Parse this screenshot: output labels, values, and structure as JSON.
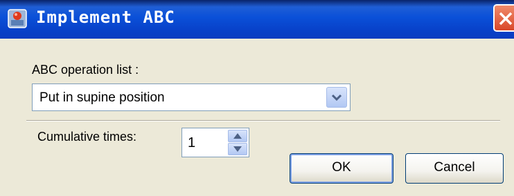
{
  "window": {
    "title": "Implement ABC"
  },
  "form": {
    "operation_list_label": "ABC operation list :",
    "operation_selected": "Put in supine position",
    "cumulative_label": "Cumulative times:",
    "cumulative_value": "1"
  },
  "buttons": {
    "ok": "OK",
    "cancel": "Cancel"
  },
  "icons": {
    "app": "app-icon",
    "close": "close-icon",
    "dropdown": "chevron-down-icon",
    "spin_up": "arrow-up-icon",
    "spin_down": "arrow-down-icon"
  },
  "colors": {
    "titlebar": "#0a50d8",
    "close_button": "#d9482a",
    "dialog_background": "#ece9d8",
    "input_border": "#7f9db9"
  }
}
